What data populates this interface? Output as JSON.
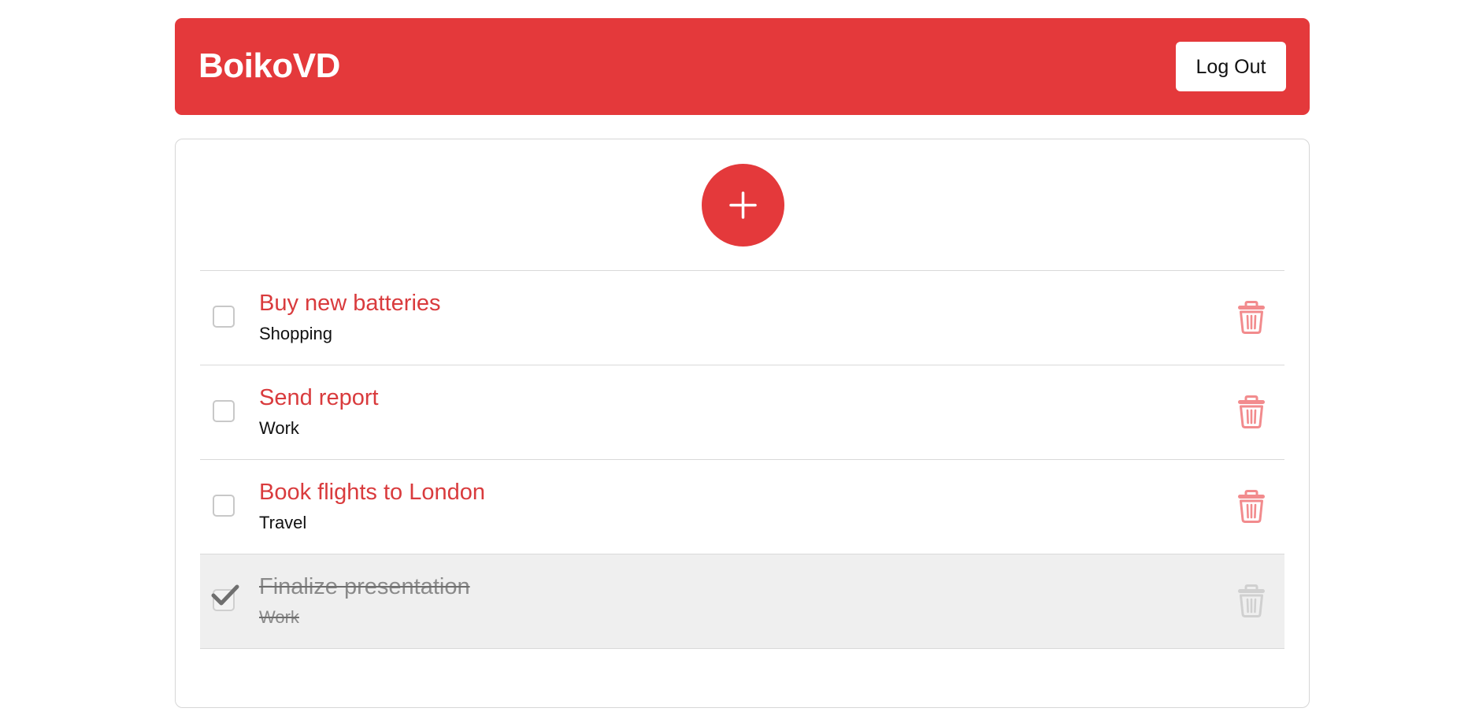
{
  "header": {
    "brand": "BoikoVD",
    "logout_label": "Log Out"
  },
  "add_button": {
    "icon": "plus-icon"
  },
  "todos": [
    {
      "title": "Buy new batteries",
      "category": "Shopping",
      "completed": false
    },
    {
      "title": "Send report",
      "category": "Work",
      "completed": false
    },
    {
      "title": "Book flights to London",
      "category": "Travel",
      "completed": false
    },
    {
      "title": "Finalize presentation",
      "category": "Work",
      "completed": true
    }
  ],
  "icons": {
    "delete": "trash-icon",
    "check": "checkmark-icon"
  },
  "colors": {
    "accent": "#e4393b",
    "title_text": "#d93b3d",
    "trash_active": "#f28b8d",
    "trash_done": "#d0d0d0",
    "done_row_bg": "#efefef"
  }
}
